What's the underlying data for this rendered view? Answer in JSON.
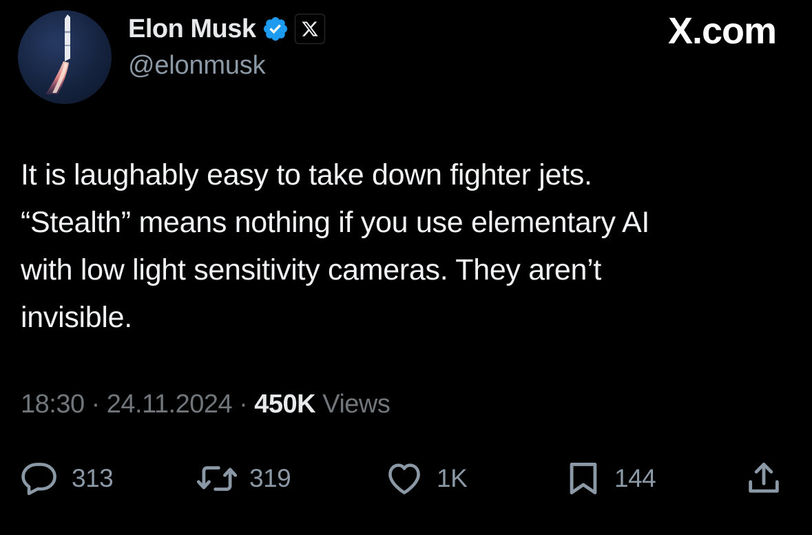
{
  "author": {
    "name": "Elon Musk",
    "handle": "@elonmusk",
    "verified": true
  },
  "site_label": "X.com",
  "tweet": {
    "lines": [
      "It is laughably easy to take down fighter jets.",
      "“Stealth” means nothing if you use elementary AI",
      "with low light sensitivity cameras. They aren’t",
      "invisible."
    ]
  },
  "meta": {
    "time": "18:30",
    "separator": "·",
    "date": "24.11.2024",
    "views_count": "450K",
    "views_label": "Views"
  },
  "actions": {
    "reply_count": "313",
    "repost_count": "319",
    "like_count": "1K",
    "bookmark_count": "144"
  },
  "icons": {
    "reply": "speech-bubble-icon",
    "repost": "repost-arrows-icon",
    "like": "heart-icon",
    "bookmark": "bookmark-icon",
    "share": "share-upload-icon",
    "verified": "verified-badge-icon",
    "x_logo": "x-logo-icon"
  },
  "colors": {
    "background": "#000000",
    "text": "#e7e9ea",
    "muted": "#71767b",
    "verified_blue": "#1d9bf0"
  }
}
